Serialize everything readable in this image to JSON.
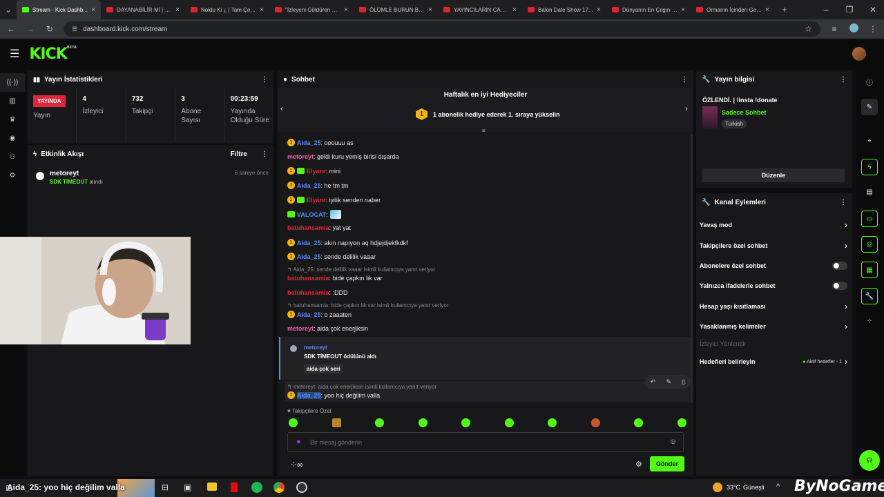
{
  "browser": {
    "tabs": [
      {
        "title": "Stream - Kick Dashb..."
      },
      {
        "title": "DAYANABİLİR Mİ | M..."
      },
      {
        "title": "Noldu Ki ¿ | Tam Çen..."
      },
      {
        "title": "\"İzleyeni Güldüren Vi..."
      },
      {
        "title": "ÖLÜMLE BURUN BU..."
      },
      {
        "title": "YAYINCILARIN CANLI..."
      },
      {
        "title": "Balon Date Show 17..."
      },
      {
        "title": "Dünyanın En Çılgın B..."
      },
      {
        "title": "Ormanın İçinden Gel..."
      }
    ],
    "url": "dashboard.kick.com/stream"
  },
  "header": {
    "logo": "KICK",
    "logo_badge": "BETA"
  },
  "stats_panel": {
    "title": "Yayın İstatistikleri",
    "live_label": "YAYINDA",
    "live_sublabel": "Yayın",
    "viewers_value": "4",
    "viewers_label": "İzleyici",
    "followers_value": "732",
    "followers_label": "Takipçi",
    "subs_value": "3",
    "subs_label": "Abone Sayısı",
    "uptime_value": "00:23:59",
    "uptime_label": "Yayında Olduğu Süre"
  },
  "activity_panel": {
    "title": "Etkinlik Akışı",
    "filter_label": "Filtre",
    "items": [
      {
        "user": "metoreyt",
        "highlight": "SDK TİMEOUT",
        "suffix": "alındı",
        "time": "6 saniye önce"
      }
    ]
  },
  "chat": {
    "title": "Sohbet",
    "gifters_title": "Haftalık en iyi Hediyeciler",
    "gifters_rank": "1",
    "gifters_text": "1 abonelik hediye ederek 1. sıraya yükselin",
    "messages": [
      {
        "user": "Aida_25",
        "text": ": ooouuu as"
      },
      {
        "user": "metoreyt",
        "text": ": geldi kuru yemiş birisi dışarda"
      },
      {
        "user": "Elyanr",
        "text": ": mini"
      },
      {
        "user": "Aida_25",
        "text": ": he tm tm"
      },
      {
        "user": "Elyanr",
        "text": ": iyilik senden naber"
      },
      {
        "user": "VALOCAT",
        "text": ":"
      },
      {
        "user": "batuhansamia",
        "text": ": yat yat"
      },
      {
        "user": "Aida_25",
        "text": ": akın napıyon aq hdjejdjekfkdkf"
      },
      {
        "user": "Aida_25",
        "text": ": sende delilik vaaar"
      },
      {
        "user": "batuhansamia",
        "text": ": bide çapkın lik var"
      },
      {
        "user": "batuhansamia",
        "text": ": :DDD"
      },
      {
        "user": "Aida_25",
        "text": ": o zaaaten"
      },
      {
        "user": "metoreyt",
        "text": ": aida çok enerjiksin"
      },
      {
        "user": "Aida_25",
        "text": ": yoo hiç değilim valla"
      }
    ],
    "replies": [
      "Aida_25: sende delilik vaaar isimli kullanıcıya yanıt veriyor",
      "batuhansamia: bide çapkın lik var isimli kullanıcıya yanıt veriyor",
      "metoreyt: aida çok enerjiksin isimli kullanıcıya yanıt veriyor"
    ],
    "reward": {
      "user": "metoreyt",
      "text": "SDK TİMEOUT ödülünü aldı",
      "note": "aida çok seri"
    },
    "followers_only": "Takipçilere Özel",
    "input_placeholder": "Bir mesaj gönderin",
    "send_label": "Gönder"
  },
  "stream_info": {
    "title": "Yayın bilgisi",
    "stream_title": "ÖZLENDİ. | !insta !donate",
    "category": "Sadece Sohbet",
    "language": "Turkish",
    "edit_label": "Düzenle"
  },
  "channel_actions": {
    "title": "Kanal Eylemleri",
    "slow_mode": "Yavaş mod",
    "followers_chat": "Takipçilere özel sohbet",
    "subs_chat": "Abonelere özel sohbet",
    "emotes_chat": "Yalnızca ifadelerle sohbet",
    "account_age": "Hesap yaşı kısıtlaması",
    "banned_words": "Yasaklanmış kelimeler",
    "viewer_redirect": "İzleyici Yönlendir",
    "goals_label": "Hedefleri belirleyin",
    "active_goals": "Aktif hedefler - 1"
  },
  "taskbar": {
    "overlay_text": "Aida_25: yoo hiç değilim valla",
    "weather_temp": "33°C",
    "weather_desc": "Güneşli",
    "watermark": "ByNoGame"
  }
}
